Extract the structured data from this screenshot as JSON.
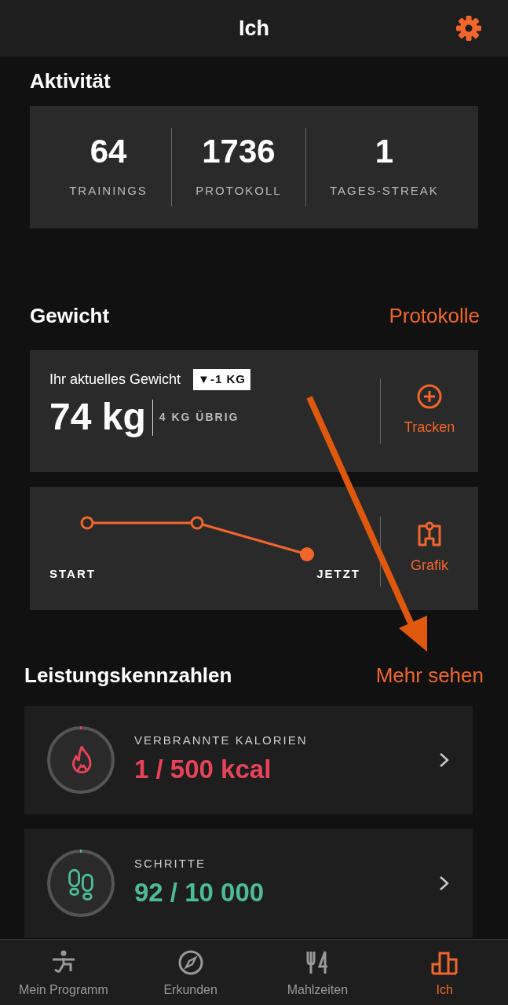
{
  "header": {
    "title": "Ich"
  },
  "activity": {
    "title": "Aktivität",
    "stats": [
      {
        "value": "64",
        "label": "TRAININGS"
      },
      {
        "value": "1736",
        "label": "PROTOKOLL"
      },
      {
        "value": "1",
        "label": "TAGES-STREAK"
      }
    ]
  },
  "weight": {
    "title": "Gewicht",
    "link": "Protokolle",
    "current_label": "Ihr aktuelles Gewicht",
    "change_badge": "▼-1 KG",
    "value": "74 kg",
    "remaining": "4 KG ÜBRIG",
    "track_button": "Tracken",
    "chart_start": "START",
    "chart_end": "JETZT",
    "chart_button": "Grafik"
  },
  "metrics": {
    "title": "Leistungskennzahlen",
    "link": "Mehr sehen",
    "items": [
      {
        "kind": "calories",
        "label": "VERBRANNTE KALORIEN",
        "value": "1 / 500 kcal",
        "color": "#e8435a"
      },
      {
        "kind": "steps",
        "label": "SCHRITTE",
        "value": "92 / 10 000",
        "color": "#4dbb94"
      }
    ]
  },
  "tabs": [
    {
      "kind": "program",
      "label": "Mein Programm",
      "selected": false
    },
    {
      "kind": "explore",
      "label": "Erkunden",
      "selected": false
    },
    {
      "kind": "meals",
      "label": "Mahlzeiten",
      "selected": false
    },
    {
      "kind": "me",
      "label": "Ich",
      "selected": true
    }
  ]
}
